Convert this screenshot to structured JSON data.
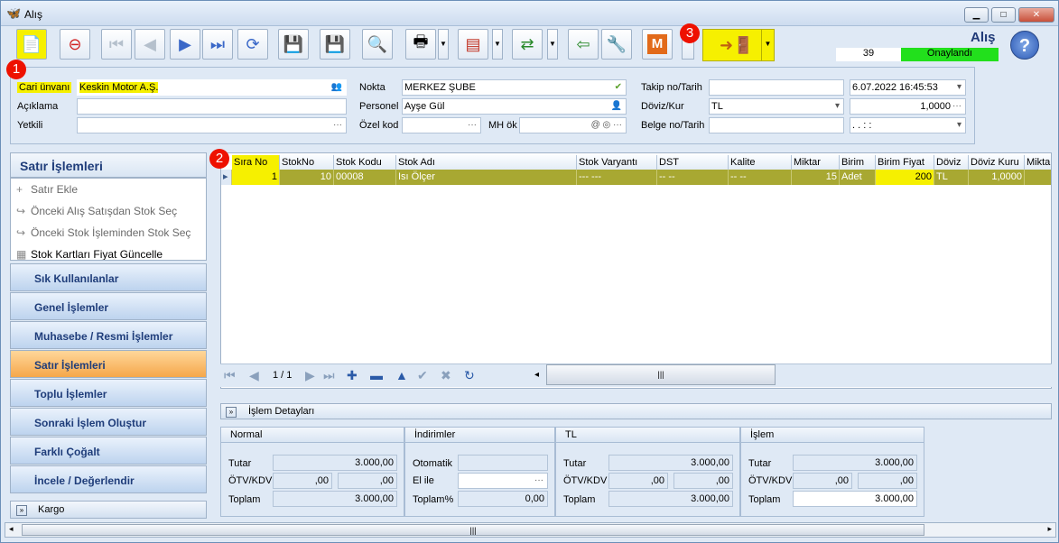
{
  "window": {
    "title": "Alış",
    "min": "▁",
    "max": "□",
    "close": "✕"
  },
  "toolbar": {
    "doc_title": "Alış",
    "doc_count": "39",
    "doc_status": "Onaylandı",
    "m_label": "M",
    "help": "?"
  },
  "badges": [
    "1",
    "2",
    "3"
  ],
  "header": {
    "cari_label": "Cari ünvanı",
    "cari_value": "Keskin Motor A.Ş.",
    "aciklama_label": "Açıklama",
    "aciklama_value": "",
    "yetkili_label": "Yetkili",
    "yetkili_value": "",
    "nokta_label": "Nokta",
    "nokta_value": "MERKEZ ŞUBE",
    "personel_label": "Personel",
    "personel_value": "Ayşe Gül",
    "ozel_label": "Özel kod",
    "ozel_value": "",
    "mh_label": "MH ök",
    "mh_value": "",
    "takip_label": "Takip no/Tarih",
    "takip_value": "",
    "tarih_value": "6.07.2022 16:45:53",
    "doviz_label": "Döviz/Kur",
    "doviz_value": "TL",
    "kur_value": "1,0000",
    "belge_label": "Belge no/Tarih",
    "belge_value": "",
    "belge_tarih": ". .     :  :"
  },
  "left": {
    "title": "Satır İşlemleri",
    "items": [
      "Satır Ekle",
      "Önceki Alış Satışdan Stok Seç",
      "Önceki Stok İşleminden Stok Seç",
      "Stok Kartları Fiyat Güncelle"
    ],
    "groups": [
      "Sık Kullanılanlar",
      "Genel İşlemler",
      "Muhasebe / Resmi İşlemler",
      "Satır İşlemleri",
      "Toplu İşlemler",
      "Sonraki İşlem Oluştur",
      "Farklı Çoğalt",
      "İncele / Değerlendir"
    ],
    "kargo": "Kargo"
  },
  "grid": {
    "columns": [
      "Sıra No",
      "StokNo",
      "Stok Kodu",
      "Stok Adı",
      "Stok Varyantı",
      "DST",
      "Kalite",
      "Miktar",
      "Birim",
      "Birim Fiyat",
      "Döviz",
      "Döviz Kuru",
      "Miktar"
    ],
    "row": {
      "sira": "1",
      "stokno": "10",
      "kod": "00008",
      "adi": "Isı Ölçer",
      "varyant": "--- ---",
      "dst": "-- --",
      "kalite": "-- --",
      "miktar": "15",
      "birim": "Adet",
      "fiyat": "200",
      "doviz": "TL",
      "kur": "1,0000"
    },
    "pager": "1 / 1"
  },
  "details": {
    "title": "İşlem Detayları",
    "normal": {
      "h": "Normal",
      "tutar_l": "Tutar",
      "tutar": "3.000,00",
      "otv_l": "ÖTV/KDV",
      "otv1": ",00",
      "otv2": ",00",
      "toplam_l": "Toplam",
      "toplam": "3.000,00"
    },
    "indirim": {
      "h": "İndirimler",
      "oto_l": "Otomatik",
      "oto": "",
      "elle_l": "El ile",
      "elle": "",
      "top_l": "Toplam%",
      "top": "0,00"
    },
    "tl": {
      "h": "TL",
      "tutar_l": "Tutar",
      "tutar": "3.000,00",
      "otv_l": "ÖTV/KDV",
      "otv1": ",00",
      "otv2": ",00",
      "toplam_l": "Toplam",
      "toplam": "3.000,00"
    },
    "islem": {
      "h": "İşlem",
      "tutar_l": "Tutar",
      "tutar": "3.000,00",
      "otv_l": "ÖTV/KDV",
      "otv1": ",00",
      "otv2": ",00",
      "toplam_l": "Toplam",
      "toplam": "3.000,00"
    }
  }
}
